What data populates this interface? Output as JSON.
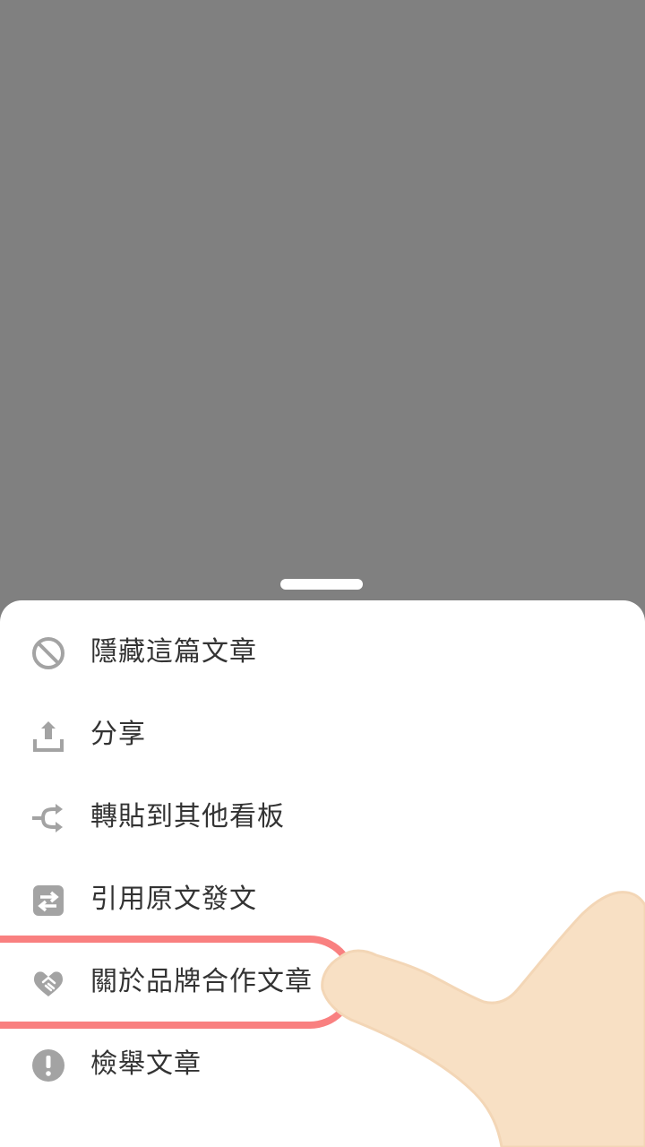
{
  "menu": {
    "items": [
      {
        "label": "隱藏這篇文章",
        "icon": "block-icon"
      },
      {
        "label": "分享",
        "icon": "share-upload-icon"
      },
      {
        "label": "轉貼到其他看板",
        "icon": "repost-icon"
      },
      {
        "label": "引用原文發文",
        "icon": "quote-repost-icon"
      },
      {
        "label": "關於品牌合作文章",
        "icon": "handshake-icon"
      },
      {
        "label": "檢舉文章",
        "icon": "report-exclamation-icon"
      }
    ]
  },
  "colors": {
    "overlay": "#808080",
    "sheet": "#ffffff",
    "icon": "#a3a3a3",
    "text": "#333333",
    "highlight": "#f98080",
    "hand": "#f8e0c4"
  }
}
